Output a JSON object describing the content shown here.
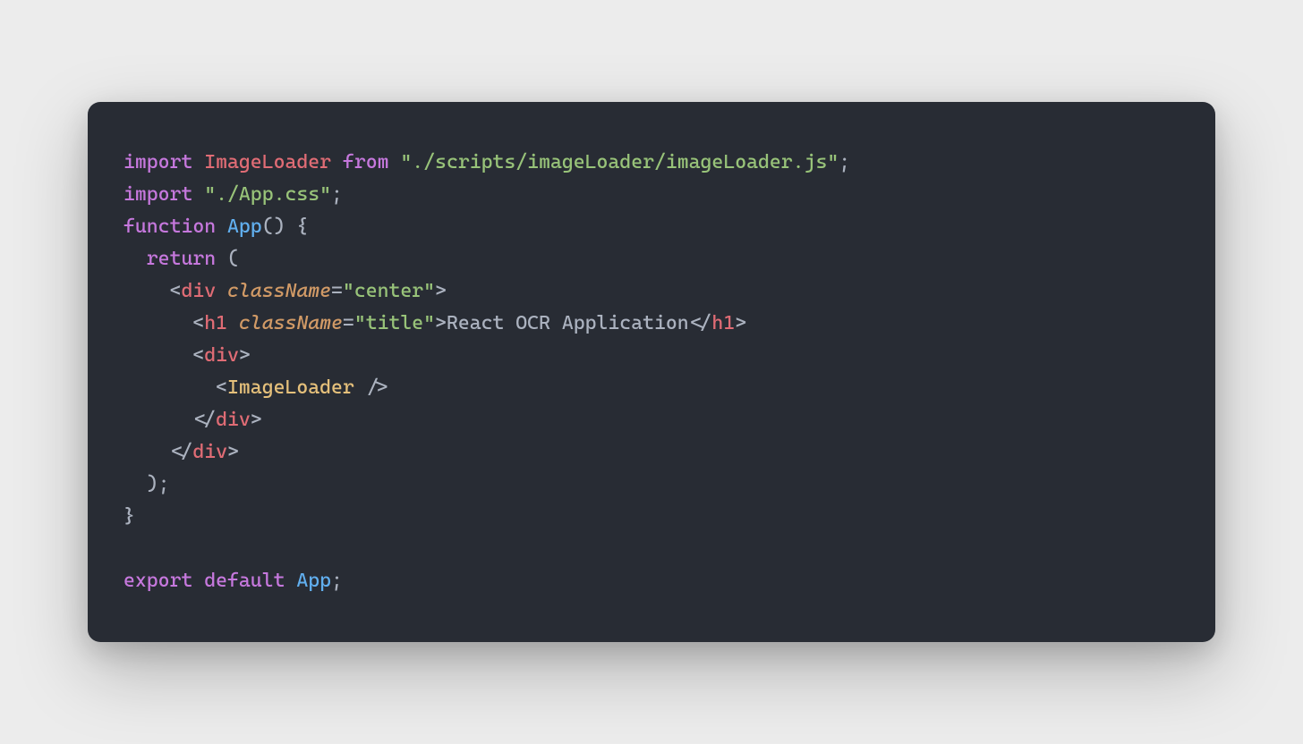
{
  "code": {
    "line1": {
      "kw_import": "import",
      "name": "ImageLoader",
      "kw_from": "from",
      "str": "\"./scripts/imageLoader/imageLoader.js\"",
      "semi": ";"
    },
    "line2": {
      "kw_import": "import",
      "str": "\"./App.css\"",
      "semi": ";"
    },
    "line3": {
      "kw_function": "function",
      "name": "App",
      "parens": "()",
      "brace": " {"
    },
    "line4": {
      "indent": "  ",
      "kw_return": "return",
      "paren": " ("
    },
    "line5": {
      "indent": "    ",
      "lt": "<",
      "tag": "div",
      "sp": " ",
      "attr": "className",
      "eq": "=",
      "val": "\"center\"",
      "gt": ">"
    },
    "line6": {
      "indent": "      ",
      "lt": "<",
      "tag": "h1",
      "sp": " ",
      "attr": "className",
      "eq": "=",
      "val": "\"title\"",
      "gt": ">",
      "text": "React OCR Application",
      "lt2": "</",
      "tag2": "h1",
      "gt2": ">"
    },
    "line7": {
      "indent": "      ",
      "lt": "<",
      "tag": "div",
      "gt": ">"
    },
    "line8": {
      "indent": "        ",
      "lt": "<",
      "comp": "ImageLoader",
      "sp": " ",
      "close": "/>"
    },
    "line9": {
      "indent": "      ",
      "lt": "</",
      "tag": "div",
      "gt": ">"
    },
    "line10": {
      "indent": "    ",
      "lt": "</",
      "tag": "div",
      "gt": ">"
    },
    "line11": {
      "indent": "  ",
      "paren": ");"
    },
    "line12": {
      "brace": "}"
    },
    "line13": {
      "blank": ""
    },
    "line14": {
      "kw_export": "export",
      "kw_default": "default",
      "name": "App",
      "semi": ";"
    }
  }
}
